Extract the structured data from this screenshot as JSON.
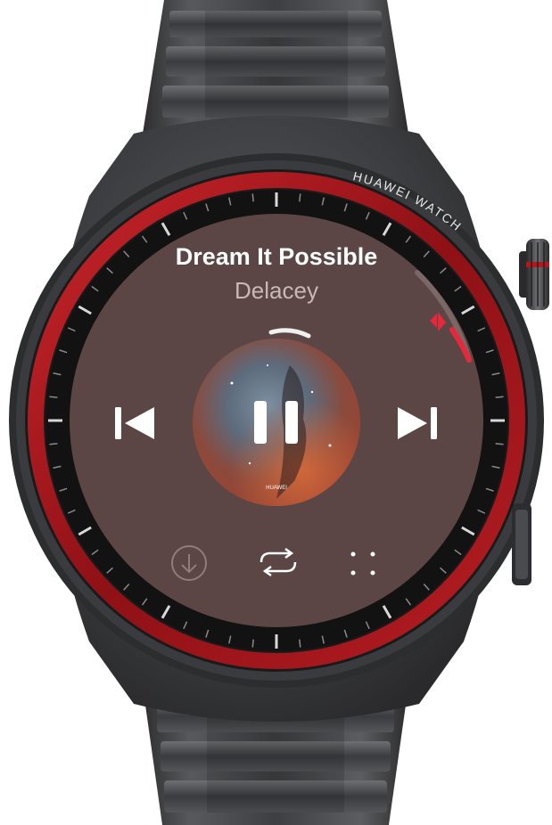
{
  "device": {
    "brand_engraving": "HUAWEI WATCH",
    "bezel_accent_color": "#b3181e",
    "screen_bg_color": "#5b4645"
  },
  "now_playing": {
    "title": "Dream It Possible",
    "artist": "Delacey",
    "album_logo_text": "HUAWEI",
    "state": "playing",
    "volume_level": 0.25,
    "accent_color": "#e8283a"
  },
  "controls": {
    "previous_icon": "skip-previous-icon",
    "pause_icon": "pause-icon",
    "next_icon": "skip-next-icon",
    "download_icon": "download-icon",
    "repeat_icon": "repeat-icon",
    "more_icon": "grid-dots-icon"
  }
}
